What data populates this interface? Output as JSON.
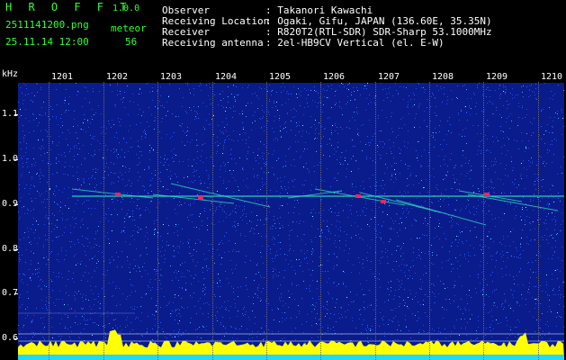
{
  "header": {
    "app_name": "H R O F F T",
    "app_version": "1.0.0",
    "filename": "2511141200.png",
    "mode": "meteor",
    "datetime": "25.11.14 12:00",
    "count": "56"
  },
  "info": {
    "observer_label": "Observer",
    "observer_value": ": Takanori Kawachi",
    "location_label": "Receiving Location",
    "location_value": ": Ogaki, Gifu, JAPAN (136.60E, 35.35N)",
    "receiver_label": "Receiver",
    "receiver_value": ": R820T2(RTL-SDR) SDR-Sharp 53.1000MHz",
    "antenna_label": "Receiving antenna",
    "antenna_value": ": 2el-HB9CV Vertical (el. E-W)"
  },
  "spectrogram": {
    "y_unit": "kHz",
    "y_ticks": [
      "1.1",
      "1.0",
      "0.9",
      "0.8",
      "0.7",
      "0.6"
    ],
    "x_ticks": [
      "1201",
      "1202",
      "1203",
      "1204",
      "1205",
      "1206",
      "1207",
      "1208",
      "1209",
      "1210"
    ],
    "colors": {
      "background": "#0a1c8c",
      "noise": "#2c5cff",
      "signal": "#30e0c0",
      "hot": "#ff2060",
      "level": "#ffff00"
    }
  }
}
